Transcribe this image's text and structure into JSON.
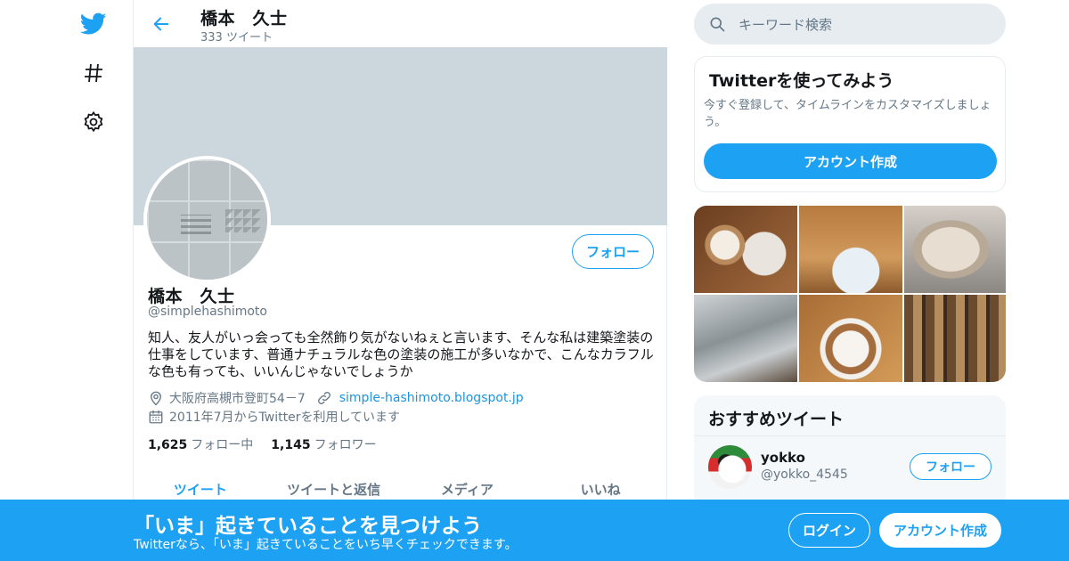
{
  "nav": {
    "icons": [
      "twitter-logo-icon",
      "hashtag-icon",
      "gear-icon"
    ]
  },
  "header": {
    "name": "橋本　久士",
    "tweet_count": "333 ツイート"
  },
  "profile": {
    "name": "橋本　久士",
    "handle": "@simplehashimoto",
    "follow_label": "フォロー",
    "bio": "知人、友人がいっ会っても全然飾り気がないねぇと言います、そんな私は建築塗装の仕事をしています、普通ナチュラルな色の塗装の施工が多いなかで、こんなカラフルな色も有っても、いいんじゃないでしょうか",
    "location": "大阪府高槻市登町54－7",
    "website": "simple-hashimoto.blogspot.jp",
    "joined": "2011年7月からTwitterを利用しています",
    "following_count": "1,625",
    "following_label": "フォロー中",
    "followers_count": "1,145",
    "followers_label": "フォロワー"
  },
  "tabs": [
    {
      "label": "ツイート",
      "active": true
    },
    {
      "label": "ツイートと返信",
      "active": false
    },
    {
      "label": "メディア",
      "active": false
    },
    {
      "label": "いいね",
      "active": false
    }
  ],
  "search": {
    "placeholder": "キーワード検索"
  },
  "signup_card": {
    "title": "Twitterを使ってみよう",
    "description": "今すぐ登録して、タイムラインをカスタマイズしましょう。",
    "button": "アカウント作成"
  },
  "recommended": {
    "title": "おすすめツイート",
    "user_name": "yokko",
    "user_handle": "@yokko_4545",
    "follow_label": "フォロー"
  },
  "bottom_bar": {
    "title": "「いま」起きていることを見つけよう",
    "subtitle": "Twitterなら、「いま」起きていることをいち早くチェックできます。",
    "login": "ログイン",
    "signup": "アカウント作成"
  },
  "colors": {
    "accent": "#1da1f2",
    "banner": "#ccd6dd",
    "muted": "#657786",
    "text": "#14171a"
  }
}
